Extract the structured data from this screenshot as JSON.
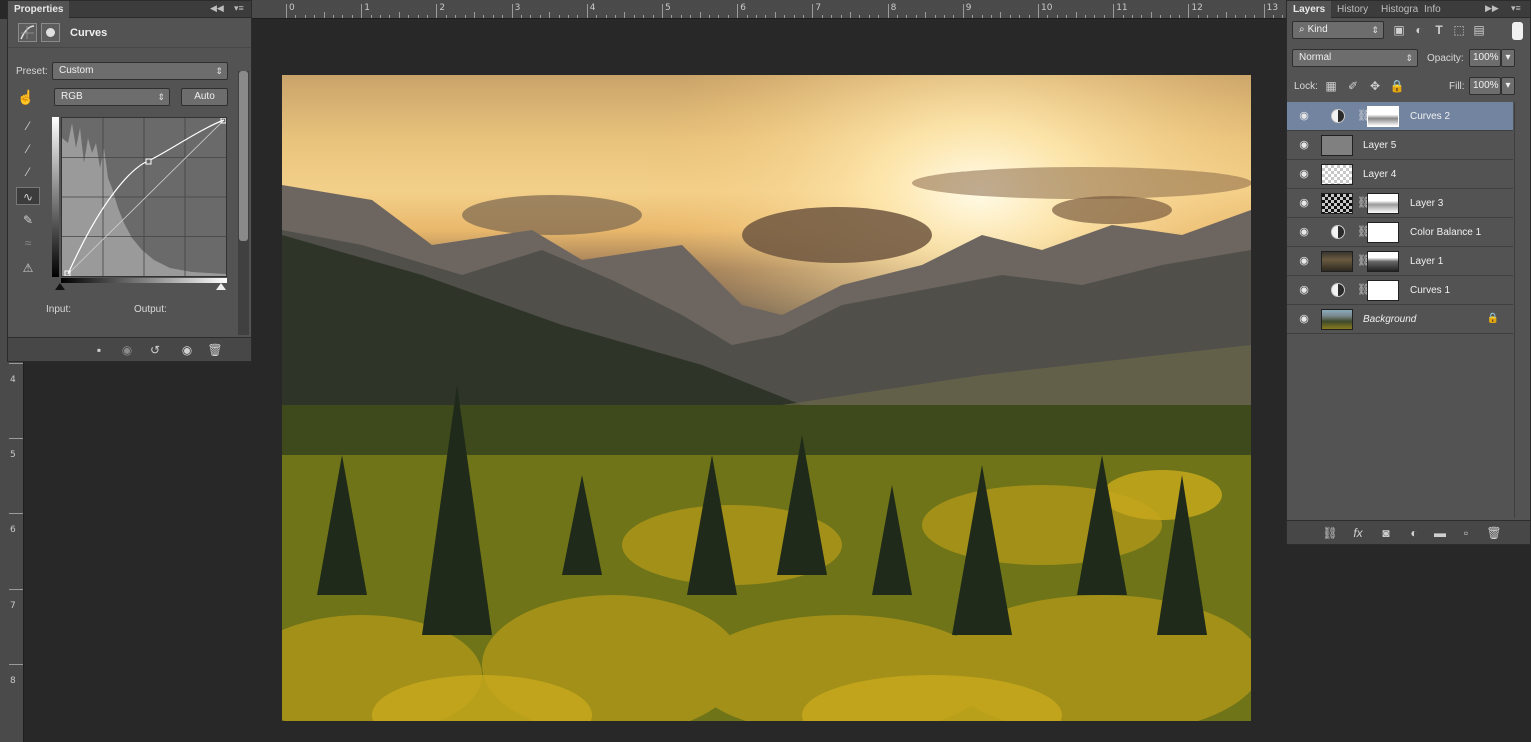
{
  "ruler": {
    "top_ticks": [
      "0",
      "1",
      "2",
      "3",
      "4",
      "5",
      "6",
      "7",
      "8",
      "9",
      "10",
      "11",
      "12",
      "13"
    ],
    "left_ticks": [
      "4",
      "5",
      "6",
      "7",
      "8"
    ]
  },
  "properties": {
    "tab_label": "Properties",
    "adjustment_title": "Curves",
    "preset_label": "Preset:",
    "preset_value": "Custom",
    "channel_value": "RGB",
    "auto_label": "Auto",
    "input_label": "Input:",
    "output_label": "Output:"
  },
  "layers_panel": {
    "tabs": [
      "Layers",
      "History",
      "Histogra",
      "Info"
    ],
    "kind_label": "Kind",
    "blend_mode": "Normal",
    "opacity_label": "Opacity:",
    "opacity_value": "100%",
    "lock_label": "Lock:",
    "fill_label": "Fill:",
    "fill_value": "100%",
    "layers": [
      {
        "name": "Curves 2",
        "type": "adjustment",
        "selected": true
      },
      {
        "name": "Layer 5",
        "type": "gray"
      },
      {
        "name": "Layer 4",
        "type": "transparent"
      },
      {
        "name": "Layer 3",
        "type": "masked-transparent"
      },
      {
        "name": "Color Balance 1",
        "type": "adjustment"
      },
      {
        "name": "Layer 1",
        "type": "photo-masked"
      },
      {
        "name": "Curves 1",
        "type": "adjustment"
      },
      {
        "name": "Background",
        "type": "background",
        "locked": true
      }
    ]
  },
  "colors": {
    "panel_bg": "#535353",
    "selected_layer": "#7384a0",
    "workspace_bg": "#282828"
  }
}
